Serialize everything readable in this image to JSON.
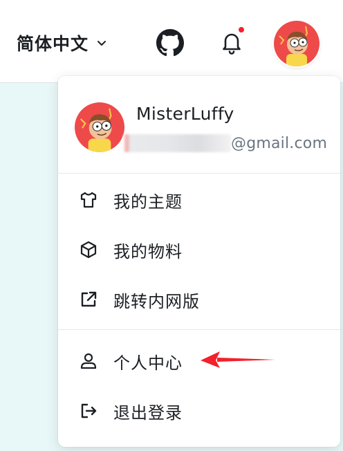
{
  "header": {
    "language_label": "简体中文",
    "language_icon": "chevron-down-icon",
    "github_icon": "github-icon",
    "notification_icon": "bell-icon",
    "notification_dot_color": "#f5222d",
    "avatar": "avatar"
  },
  "dropdown": {
    "user": {
      "name": "MisterLuffy",
      "email_suffix": "@gmail.com"
    },
    "items": [
      {
        "label": "我的主题",
        "icon": "shirt-icon"
      },
      {
        "label": "我的物料",
        "icon": "cube-icon"
      },
      {
        "label": "跳转内网版",
        "icon": "external-link-icon"
      },
      {
        "label": "个人中心",
        "icon": "user-icon"
      },
      {
        "label": "退出登录",
        "icon": "logout-icon"
      }
    ]
  },
  "annotation": {
    "icon": "red-arrow-icon",
    "color": "#f2212b"
  }
}
